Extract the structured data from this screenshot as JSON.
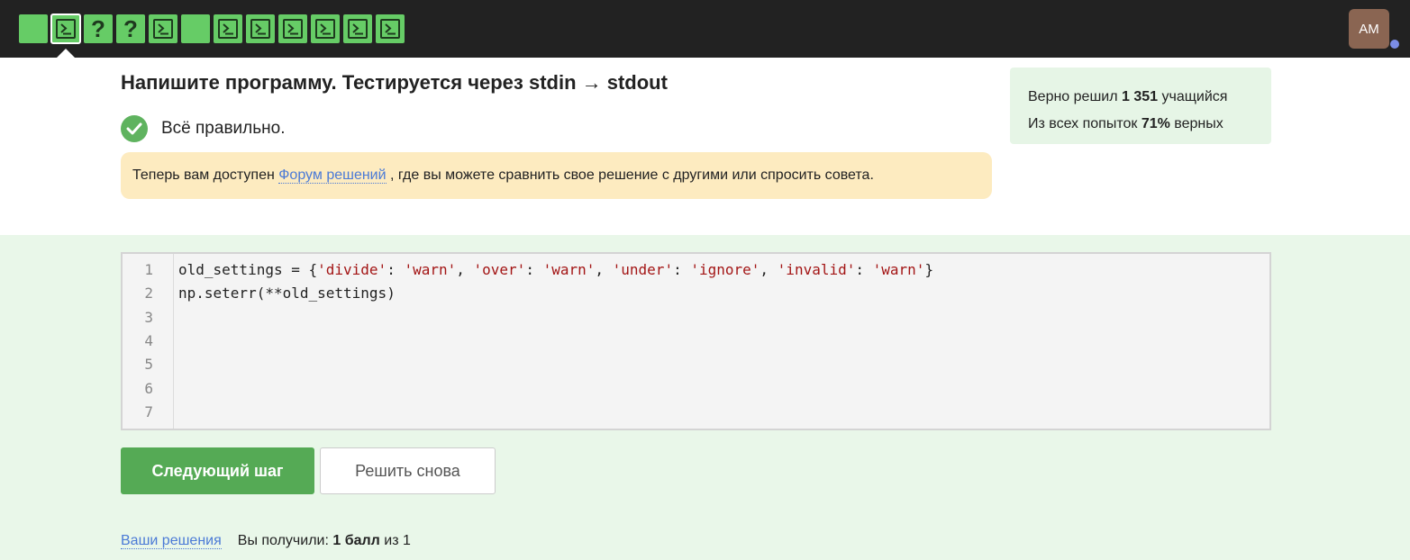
{
  "steps": [
    {
      "type": "plain",
      "current": false
    },
    {
      "type": "terminal",
      "current": true
    },
    {
      "type": "question",
      "label": "?",
      "current": false
    },
    {
      "type": "question",
      "label": "?",
      "current": false
    },
    {
      "type": "terminal",
      "current": false
    },
    {
      "type": "plain",
      "current": false
    },
    {
      "type": "terminal",
      "current": false
    },
    {
      "type": "terminal",
      "current": false
    },
    {
      "type": "terminal",
      "current": false
    },
    {
      "type": "terminal",
      "current": false
    },
    {
      "type": "terminal",
      "current": false
    },
    {
      "type": "terminal",
      "current": false
    }
  ],
  "user": {
    "initials": "AM"
  },
  "title": "Напишите программу. Тестируется через stdin → stdout",
  "status": {
    "text": "Всё правильно."
  },
  "notice": {
    "before": "Теперь вам доступен ",
    "link": "Форум решений",
    "after": " , где вы можете сравнить свое решение с другими или спросить совета."
  },
  "stats": {
    "solved_prefix": "Верно решил ",
    "solved_count": "1 351",
    "solved_suffix": " учащийся",
    "attempts_prefix": "Из всех попыток ",
    "attempts_percent": "71%",
    "attempts_suffix": " верных"
  },
  "code": {
    "line_numbers": [
      "1",
      "2",
      "3",
      "4",
      "5",
      "6",
      "7"
    ],
    "lines": [
      [
        {
          "t": "old_settings = {",
          "k": "plain"
        },
        {
          "t": "'divide'",
          "k": "str"
        },
        {
          "t": ": ",
          "k": "plain"
        },
        {
          "t": "'warn'",
          "k": "str"
        },
        {
          "t": ", ",
          "k": "plain"
        },
        {
          "t": "'over'",
          "k": "str"
        },
        {
          "t": ": ",
          "k": "plain"
        },
        {
          "t": "'warn'",
          "k": "str"
        },
        {
          "t": ", ",
          "k": "plain"
        },
        {
          "t": "'under'",
          "k": "str"
        },
        {
          "t": ": ",
          "k": "plain"
        },
        {
          "t": "'ignore'",
          "k": "str"
        },
        {
          "t": ", ",
          "k": "plain"
        },
        {
          "t": "'invalid'",
          "k": "str"
        },
        {
          "t": ": ",
          "k": "plain"
        },
        {
          "t": "'warn'",
          "k": "str"
        },
        {
          "t": "}",
          "k": "plain"
        }
      ],
      [
        {
          "t": "np.seterr(**old_settings)",
          "k": "plain"
        }
      ]
    ]
  },
  "buttons": {
    "next": "Следующий шаг",
    "retry": "Решить снова"
  },
  "footer": {
    "solutions_link": "Ваши решения",
    "score_prefix": "Вы получили: ",
    "score_value": "1 балл",
    "score_suffix": " из 1"
  },
  "colors": {
    "step_green": "#66cc66",
    "accent_green": "#55aa55",
    "link_blue": "#4b7ad6",
    "string_red": "#a31515"
  }
}
